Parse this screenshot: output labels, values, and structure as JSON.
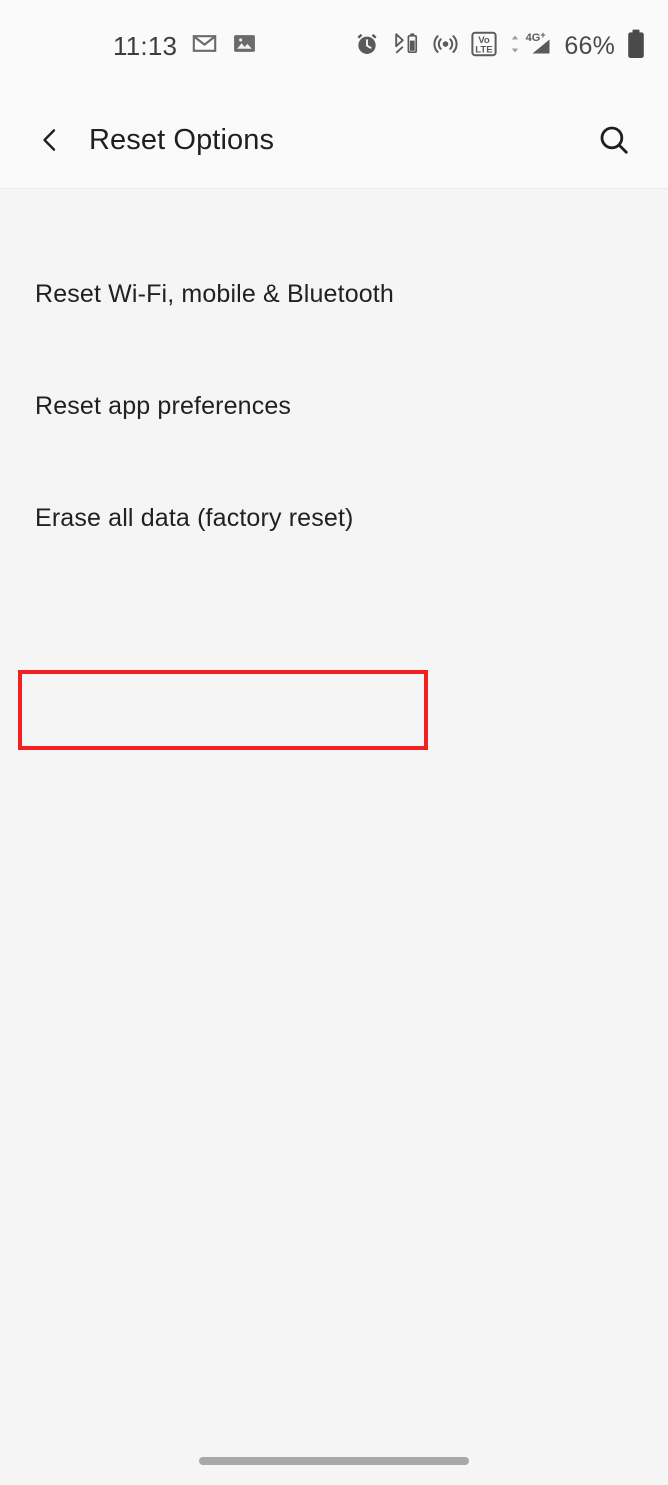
{
  "status_bar": {
    "clock": "11:13",
    "battery_percent": "66%",
    "left_icons": [
      {
        "name": "gmail-icon",
        "label": "M"
      },
      {
        "name": "photos-icon",
        "label": "image"
      }
    ],
    "right_icons": [
      {
        "name": "alarm-icon",
        "label": "alarm"
      },
      {
        "name": "bluetooth-battery-icon",
        "label": "bluetooth"
      },
      {
        "name": "hotspot-icon",
        "label": "hotspot"
      },
      {
        "name": "volte-icon",
        "label": "VoLTE",
        "line1": "Vo",
        "line2": "LTE"
      },
      {
        "name": "mobile-signal-icon",
        "label": "4G+",
        "network": "4G"
      },
      {
        "name": "battery-icon",
        "label": "battery"
      }
    ]
  },
  "header": {
    "back_label": "Back",
    "title": "Reset Options",
    "search_label": "Search"
  },
  "list": {
    "items": [
      {
        "label": "Reset Wi-Fi, mobile & Bluetooth",
        "highlighted": false
      },
      {
        "label": "Reset app preferences",
        "highlighted": false
      },
      {
        "label": "Erase all data (factory reset)",
        "highlighted": true
      }
    ]
  },
  "annotation": {
    "color": "#f22121",
    "target": "Erase all data (factory reset)"
  },
  "nav_bar": {
    "label": "Home gesture bar"
  },
  "colors": {
    "page_background": "#f5f5f5",
    "bar_background": "#fafafa",
    "primary_text": "#212121",
    "secondary_text": "#4a4a4a",
    "divider": "#ececec",
    "accent_red": "#f22121",
    "nav_pill": "#a8a8a8"
  }
}
